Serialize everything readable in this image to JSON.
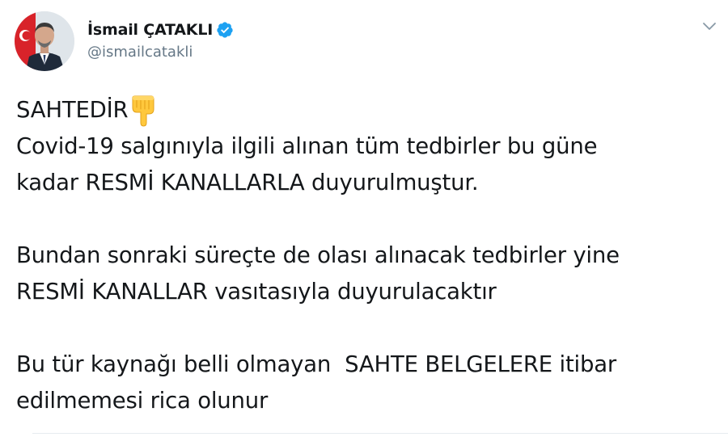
{
  "author": {
    "display_name": "İsmail ÇATAKLI",
    "handle": "@ismailcatakli",
    "verified": true
  },
  "tweet": {
    "line1": "SAHTEDİR",
    "line1_emoji_icon": "backhand-index-pointing-down-icon",
    "line2": "Covid-19 salgınıyla ilgili alınan tüm tedbirler bu güne",
    "line3": "kadar RESMİ KANALLARLA duyurulmuştur.",
    "line4": "Bundan sonraki süreçte de olası alınacak tedbirler yine",
    "line5": "RESMİ KANALLAR vasıtasıyla duyurulacaktır",
    "line6": "Bu tür kaynağı belli olmayan  SAHTE BELGELERE itibar",
    "line7": "edilmemesi rica olunur"
  },
  "colors": {
    "text": "#14171a",
    "secondary": "#657786",
    "verified_blue": "#1da1f2",
    "divider": "#e6ecf0"
  }
}
